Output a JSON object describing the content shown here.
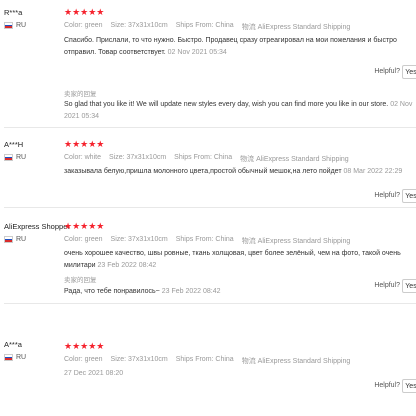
{
  "reviews": [
    {
      "buyer": "R***a",
      "country": "RU",
      "stars": "★★★★★",
      "color_label": "Color: green",
      "size_label": "Size: 37x31x10cm",
      "ships_label": "Ships From: China",
      "shipping": "物流 AliExpress Standard Shipping",
      "text": "Спасибо. Прислали, то что нужно. Быстро. Продавец сразу отреагировал на мои пожелания и быстро отправил. Товар соответствует.",
      "date": "02 Nov 2021 05:34",
      "helpful": "Helpful?",
      "yes": "Yes",
      "seller_label": "卖家的回复",
      "reply": "So glad that you like it! We will update new styles every day, wish you can find more you like in our store.",
      "reply_date": "02 Nov 2021 05:34"
    },
    {
      "buyer": "A***H",
      "country": "RU",
      "stars": "★★★★★",
      "color_label": "Color: white",
      "size_label": "Size: 37x31x10cm",
      "ships_label": "Ships From: China",
      "shipping": "物流 AliExpress Standard Shipping",
      "text": "заказывала белую,пришла молонного цвета,простой обычный мешок,на лето пойдет",
      "date": "08 Mar 2022 22:29",
      "helpful": "Helpful?",
      "yes": "Yes"
    },
    {
      "buyer": "AliExpress Shopper",
      "country": "RU",
      "stars": "★★★★★",
      "color_label": "Color: green",
      "size_label": "Size: 37x31x10cm",
      "ships_label": "Ships From: China",
      "shipping": "物流 AliExpress Standard Shipping",
      "text": "очень хорошее качество, швы ровные, ткань холщовая, цвет более зелёный, чем на фото, такой очень милитари",
      "date": "23 Feb 2022 08:42",
      "helpful": "Helpful?",
      "yes": "Yes",
      "seller_label": "卖家的回复",
      "reply": "Рада, что тебе понравилось~",
      "reply_date": "23 Feb 2022 08:42"
    },
    {
      "buyer": "A***a",
      "country": "RU",
      "stars": "★★★★★",
      "color_label": "Color: green",
      "size_label": "Size: 37x31x10cm",
      "ships_label": "Ships From: China",
      "shipping": "物流 AliExpress Standard Shipping",
      "date": "27 Dec 2021 08:20",
      "helpful": "Helpful?",
      "yes": "Yes"
    }
  ]
}
